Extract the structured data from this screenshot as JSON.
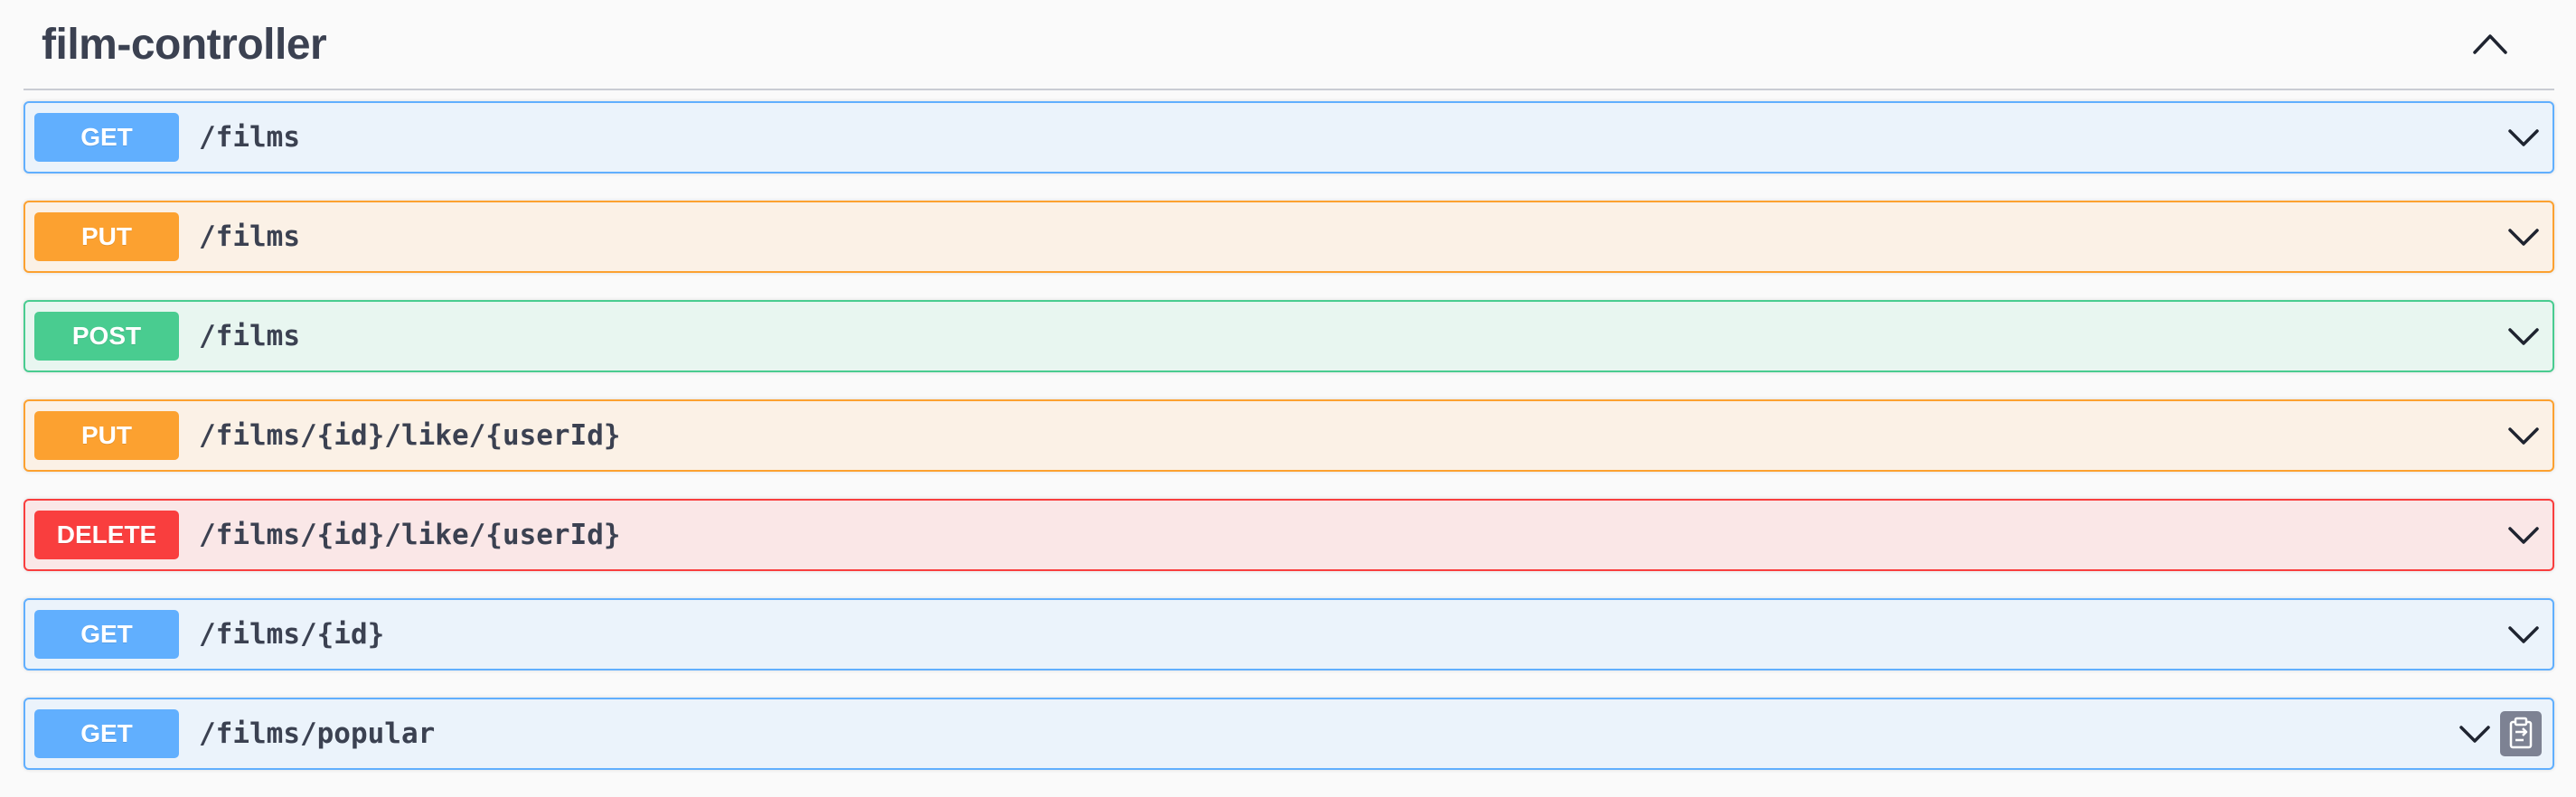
{
  "tag": {
    "title": "film-controller",
    "collapse_icon": "chevron-up-icon"
  },
  "operations": [
    {
      "method": "GET",
      "path": "/films",
      "color": "#61affe",
      "expand_icon": "chevron-down-icon"
    },
    {
      "method": "PUT",
      "path": "/films",
      "color": "#fca130",
      "expand_icon": "chevron-down-icon"
    },
    {
      "method": "POST",
      "path": "/films",
      "color": "#49cc90",
      "expand_icon": "chevron-down-icon"
    },
    {
      "method": "PUT",
      "path": "/films/{id}/like/{userId}",
      "color": "#fca130",
      "expand_icon": "chevron-down-icon"
    },
    {
      "method": "DELETE",
      "path": "/films/{id}/like/{userId}",
      "color": "#f93e3e",
      "expand_icon": "chevron-down-icon"
    },
    {
      "method": "GET",
      "path": "/films/{id}",
      "color": "#61affe",
      "expand_icon": "chevron-down-icon"
    },
    {
      "method": "GET",
      "path": "/films/popular",
      "color": "#61affe",
      "expand_icon": "chevron-down-icon",
      "copy_icon": "clipboard-icon"
    }
  ],
  "colors": {
    "get": "#61affe",
    "put": "#fca130",
    "post": "#49cc90",
    "delete": "#f93e3e",
    "text": "#3b4151"
  }
}
